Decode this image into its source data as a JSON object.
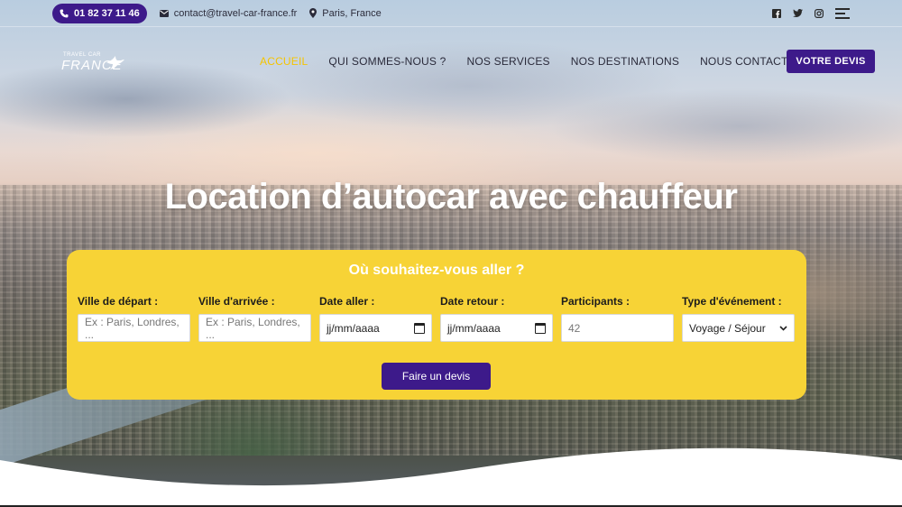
{
  "topbar": {
    "phone": "01 82 37 11 46",
    "email": "contact@travel-car-france.fr",
    "location": "Paris, France",
    "social": [
      "facebook-icon",
      "twitter-icon",
      "instagram-icon",
      "menu-icon"
    ]
  },
  "logo": {
    "small": "TRAVEL CAR",
    "big": "FRANCE"
  },
  "nav": {
    "items": [
      "ACCUEIL",
      "QUI SOMMES-NOUS ?",
      "NOS SERVICES",
      "NOS DESTINATIONS",
      "NOUS CONTACTER"
    ],
    "active_index": 0,
    "cta": "VOTRE DEVIS"
  },
  "hero": {
    "headline": "Location d’autocar avec chauffeur"
  },
  "booking": {
    "title": "Où souhaitez-vous aller ?",
    "fields": [
      {
        "label": "Ville de départ :",
        "placeholder": "Ex : Paris, Londres, ..."
      },
      {
        "label": "Ville d'arrivée :",
        "placeholder": "Ex : Paris, Londres, ..."
      },
      {
        "label": "Date aller :",
        "value": "jj/mm/aaaa"
      },
      {
        "label": "Date retour :",
        "value": "jj/mm/aaaa"
      },
      {
        "label": "Participants :",
        "placeholder": "42"
      },
      {
        "label": "Type d'événement :",
        "value": "Voyage / Séjour"
      }
    ],
    "submit": "Faire un devis"
  },
  "colors": {
    "primary": "#3d1a8a",
    "accent": "#f7d336",
    "active_nav": "#f5c400"
  }
}
